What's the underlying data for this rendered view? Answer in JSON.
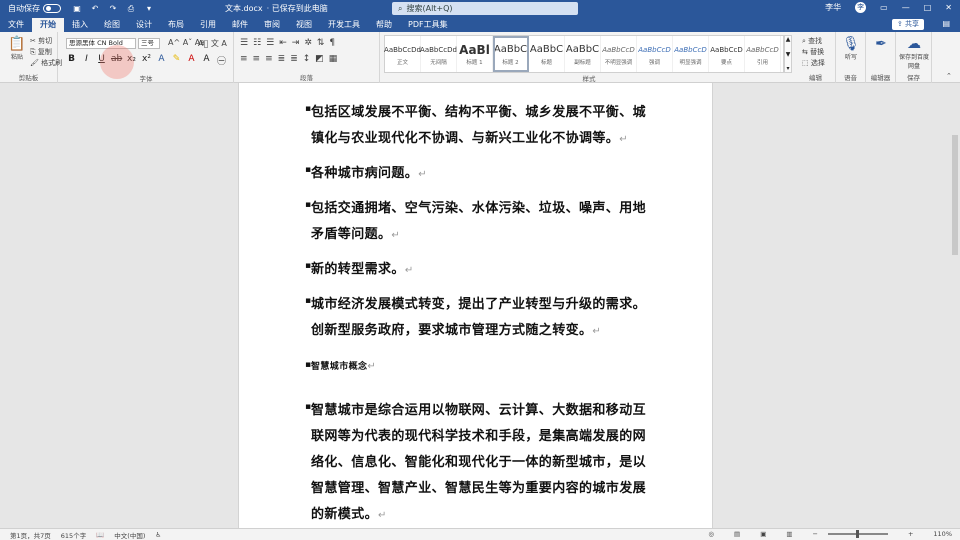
{
  "titlebar": {
    "autosave_label": "自动保存",
    "toggle_state": "关",
    "filename": "文本.docx",
    "save_status": "· 已保存到此电脑",
    "search_placeholder": "搜索(Alt+Q)",
    "user": "李华"
  },
  "tabs": [
    "文件",
    "开始",
    "插入",
    "绘图",
    "设计",
    "布局",
    "引用",
    "邮件",
    "审阅",
    "视图",
    "开发工具",
    "帮助",
    "PDF工具集"
  ],
  "active_tab": "开始",
  "share_label": "共享",
  "ribbon": {
    "clipboard": {
      "paste": "粘贴",
      "cut": "剪切",
      "copy": "复制",
      "format_painter": "格式刷",
      "label": "剪贴板"
    },
    "font": {
      "font_name": "思源黑体 CN Bold",
      "font_size": "三号",
      "label": "字体"
    },
    "paragraph_label": "段落",
    "styles": [
      {
        "preview": "AaBbCcDd",
        "name": "正文"
      },
      {
        "preview": "AaBbCcDd",
        "name": "无间隔"
      },
      {
        "preview": "AaBl",
        "name": "标题 1"
      },
      {
        "preview": "AaBbC",
        "name": "标题 2"
      },
      {
        "preview": "AaBbC",
        "name": "标题"
      },
      {
        "preview": "AaBbC",
        "name": "副标题"
      },
      {
        "preview": "AaBbCcD",
        "name": "不明显强调"
      },
      {
        "preview": "AaBbCcD",
        "name": "强调"
      },
      {
        "preview": "AaBbCcD",
        "name": "明显强调"
      },
      {
        "preview": "AaBbCcD",
        "name": "要点"
      },
      {
        "preview": "AaBbCcD",
        "name": "引用"
      }
    ],
    "styles_label": "样式",
    "editing": {
      "find": "查找",
      "replace": "替换",
      "select": "选择",
      "label": "编辑"
    },
    "voice": {
      "dictate": "听写",
      "label": "语音"
    },
    "editor": {
      "label": "编辑器"
    },
    "save_cloud": {
      "label": "保存到百度网盘",
      "group": "保存"
    }
  },
  "document": {
    "lines": [
      {
        "text": "包括区域发展不平衡、结构不平衡、城乡发展不平衡、城",
        "bullet": true
      },
      {
        "text": "镇化与农业现代化不协调、与新兴工业化不协调等。",
        "mark": "↵"
      },
      {
        "text": "各种城市病问题。",
        "bullet": true,
        "mark": "↵"
      },
      {
        "text": "包括交通拥堵、空气污染、水体污染、垃圾、噪声、用地",
        "bullet": true
      },
      {
        "text": "矛盾等问题。",
        "mark": "↵"
      },
      {
        "text": "新的转型需求。",
        "bullet": true,
        "mark": "↵"
      },
      {
        "text": "城市经济发展模式转变，提出了产业转型与升级的需求。",
        "bullet": true
      },
      {
        "text": "创新型服务政府，要求城市管理方式随之转变。",
        "mark": "↵"
      },
      {
        "text": "智慧城市概念",
        "bullet": true,
        "mark": "↵",
        "small": true
      },
      {
        "text": "智慧城市是综合运用以物联网、云计算、大数据和移动互",
        "bullet": true
      },
      {
        "text": "联网等为代表的现代科学技术和手段，是集高端发展的网"
      },
      {
        "text": "络化、信息化、智能化和现代化于一体的新型城市，是以"
      },
      {
        "text": "智慧管理、智慧产业、智慧民生等为重要内容的城市发展"
      },
      {
        "text": "的新模式。",
        "mark": "↵"
      }
    ]
  },
  "status": {
    "page": "第1页，共7页",
    "words": "615个字",
    "language": "中文(中国)",
    "zoom": "110%"
  },
  "colors": {
    "brand": "#2b579a",
    "ribbon": "#f3f3f3",
    "canvas": "#e6e6e6"
  }
}
